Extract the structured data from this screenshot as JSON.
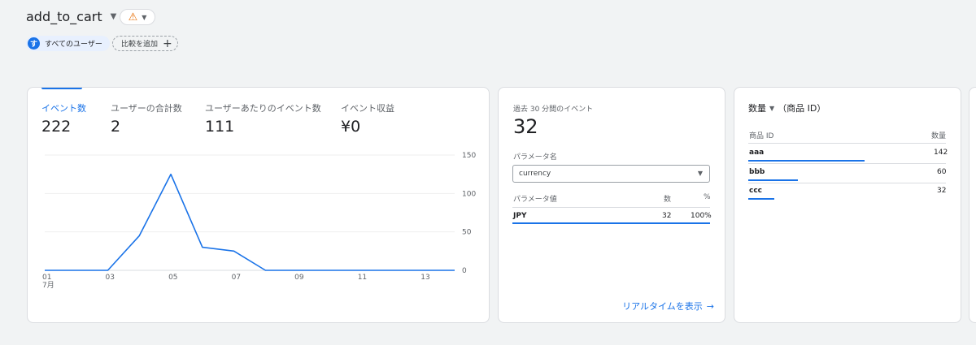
{
  "header": {
    "title": "add_to_cart",
    "segment_avatar": "す",
    "segment_label": "すべてのユーザー",
    "compare_label": "比較を追加",
    "accent": "#1a73e8",
    "warning_color": "#e8710a"
  },
  "metrics": [
    {
      "label": "イベント数",
      "value": "222"
    },
    {
      "label": "ユーザーの合計数",
      "value": "2"
    },
    {
      "label": "ユーザーあたりのイベント数",
      "value": "111"
    },
    {
      "label": "イベント収益",
      "value": "¥0"
    }
  ],
  "chart_data": {
    "type": "line",
    "x_ticks": [
      "01",
      "03",
      "05",
      "07",
      "09",
      "11",
      "13"
    ],
    "x_sublabel": "7月",
    "y_ticks": [
      "150",
      "100",
      "50",
      "0"
    ],
    "ylim": [
      0,
      150
    ],
    "x": [
      1,
      2,
      3,
      4,
      5,
      6,
      7,
      8,
      9,
      10,
      11,
      12,
      13,
      14
    ],
    "values": [
      0,
      0,
      0,
      45,
      125,
      30,
      25,
      0,
      0,
      0,
      0,
      0,
      0,
      0
    ],
    "color": "#1a73e8"
  },
  "realtime": {
    "title": "過去 30 分間のイベント",
    "count": "32",
    "param_name_label": "パラメータ名",
    "param_selected": "currency",
    "col_param_value": "パラメータ値",
    "col_count": "数",
    "col_percent": "%",
    "rows": [
      {
        "value": "JPY",
        "count": "32",
        "percent": "100%",
        "fraction": 1.0
      }
    ],
    "link_label": "リアルタイムを表示"
  },
  "items_card": {
    "title": "数量",
    "subtitle": "（商品 ID）",
    "col_item": "商品 ID",
    "col_qty": "数量",
    "rows": [
      {
        "name": "aaa",
        "qty": "142",
        "fraction": 0.59
      },
      {
        "name": "bbb",
        "qty": "60",
        "fraction": 0.25
      },
      {
        "name": "ccc",
        "qty": "32",
        "fraction": 0.13
      }
    ]
  }
}
